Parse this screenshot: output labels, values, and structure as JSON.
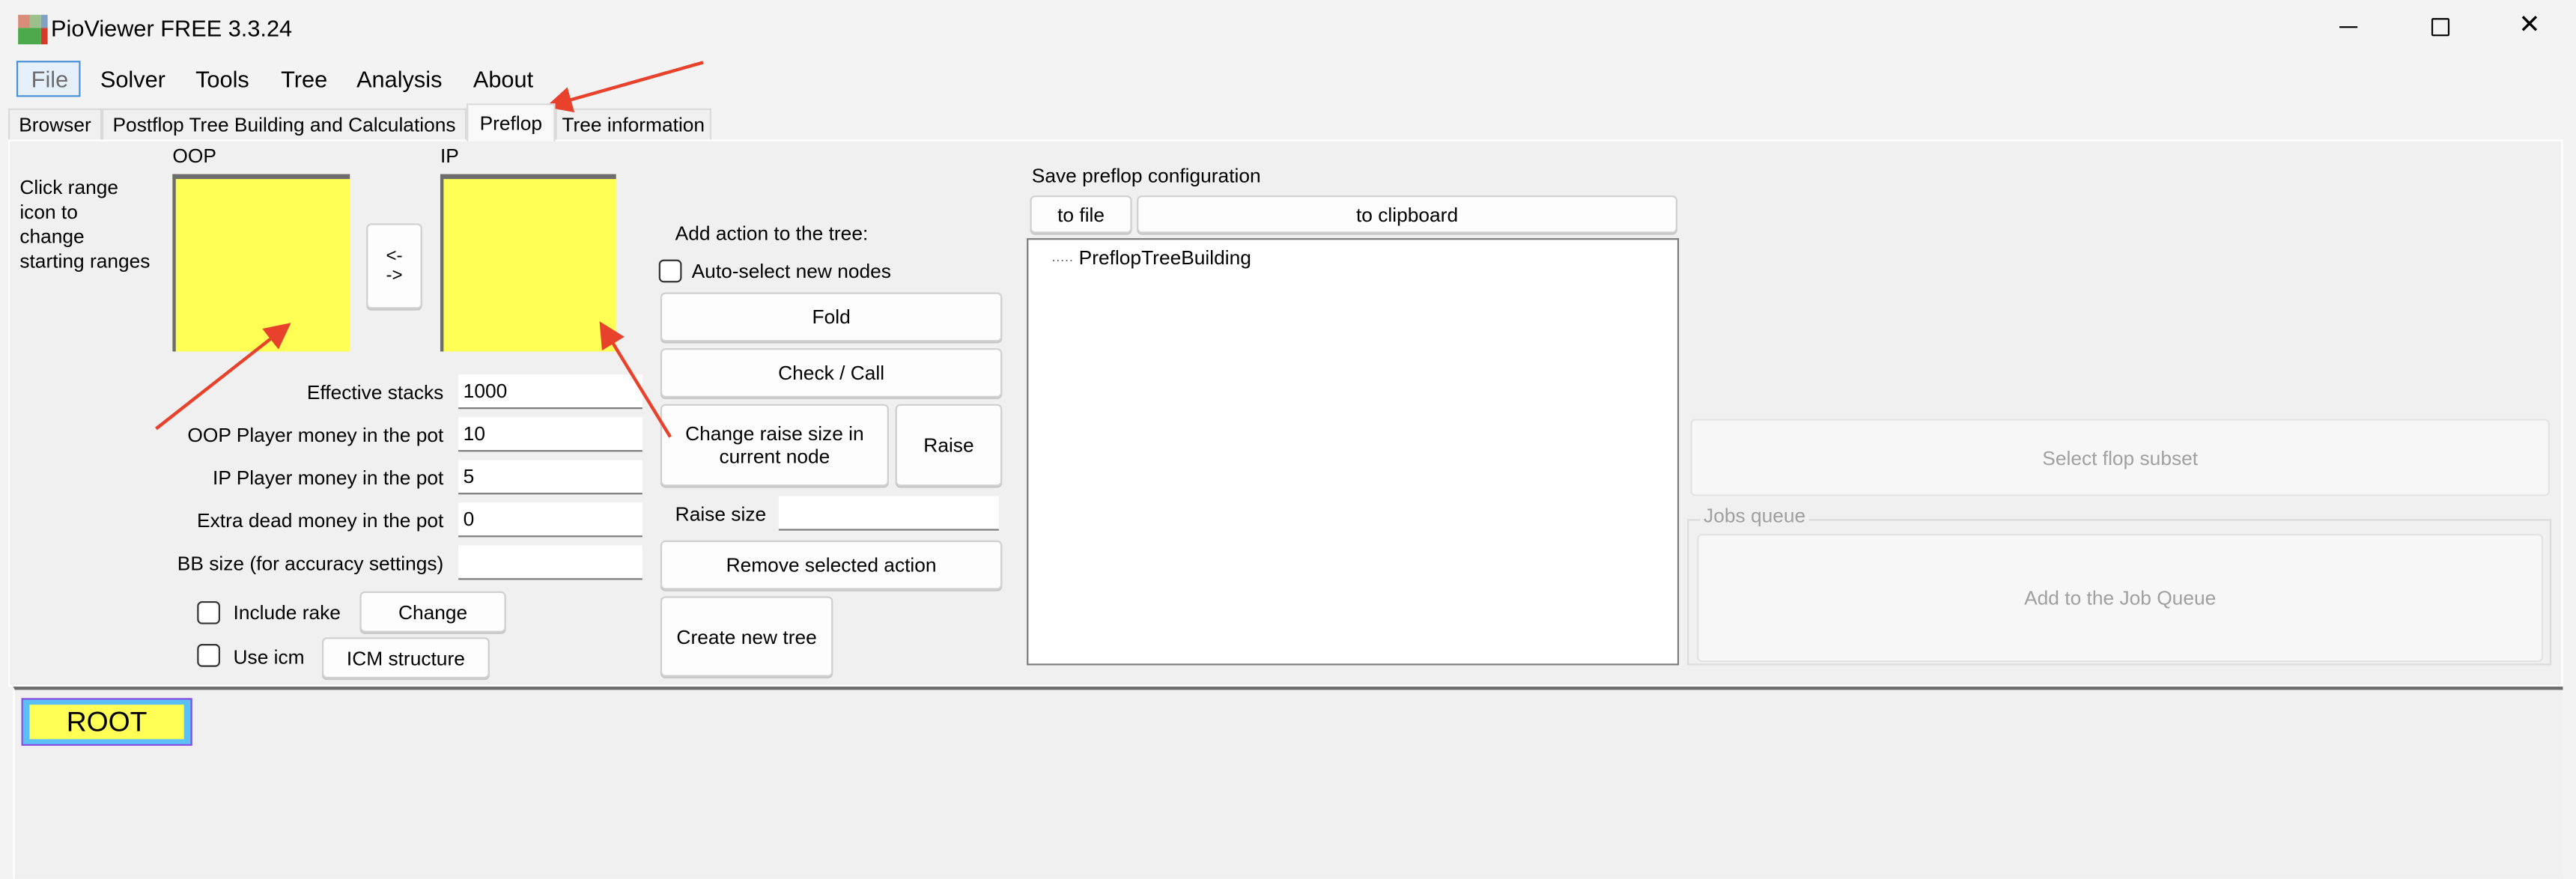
{
  "window": {
    "title": "PioViewer FREE 3.3.24",
    "controls": [
      "minimize-icon",
      "maximize-icon",
      "close-icon"
    ]
  },
  "menu": {
    "items": [
      "File",
      "Solver",
      "Tools",
      "Tree",
      "Analysis",
      "About"
    ]
  },
  "tabs": {
    "items": [
      "Browser",
      "Postflop Tree Building and Calculations",
      "Preflop",
      "Tree information"
    ],
    "selected": "Preflop"
  },
  "ranges": {
    "hint": [
      "Click range",
      "icon to",
      "change",
      "starting ranges"
    ],
    "oop_label": "OOP",
    "ip_label": "IP",
    "swap_label": [
      "<-",
      "->"
    ],
    "range_color": "#ffff55"
  },
  "settings": {
    "effective_stacks": {
      "label": "Effective stacks",
      "value": "1000"
    },
    "oop_money": {
      "label": "OOP Player money in the pot",
      "value": "10"
    },
    "ip_money": {
      "label": "IP Player money in the pot",
      "value": "5"
    },
    "dead_money": {
      "label": "Extra dead money in the pot",
      "value": "0"
    },
    "bb_size": {
      "label": "BB size (for accuracy settings)",
      "value": ""
    },
    "include_rake": {
      "label": "Include rake",
      "checked": false,
      "button": "Change"
    },
    "use_icm": {
      "label": "Use icm",
      "checked": false,
      "button": "ICM structure"
    }
  },
  "actions": {
    "title": "Add action to the tree:",
    "auto_select": {
      "label": "Auto-select new nodes",
      "checked": false
    },
    "fold": "Fold",
    "check_call": "Check / Call",
    "change_raise": "Change raise size in current node",
    "raise": "Raise",
    "raise_size_label": "Raise size",
    "raise_size_value": "",
    "remove": "Remove selected action",
    "create": "Create new tree"
  },
  "save": {
    "title": "Save preflop configuration",
    "to_file": "to file",
    "to_clipboard": "to clipboard"
  },
  "tree": {
    "items": [
      "PreflopTreeBuilding"
    ],
    "prefix": "·····"
  },
  "right": {
    "select_flop": "Select flop subset",
    "jobs_group": "Jobs queue",
    "add_job": "Add to the Job Queue"
  },
  "bottom": {
    "root_node": "ROOT"
  },
  "annotation_color": "#e8412c"
}
